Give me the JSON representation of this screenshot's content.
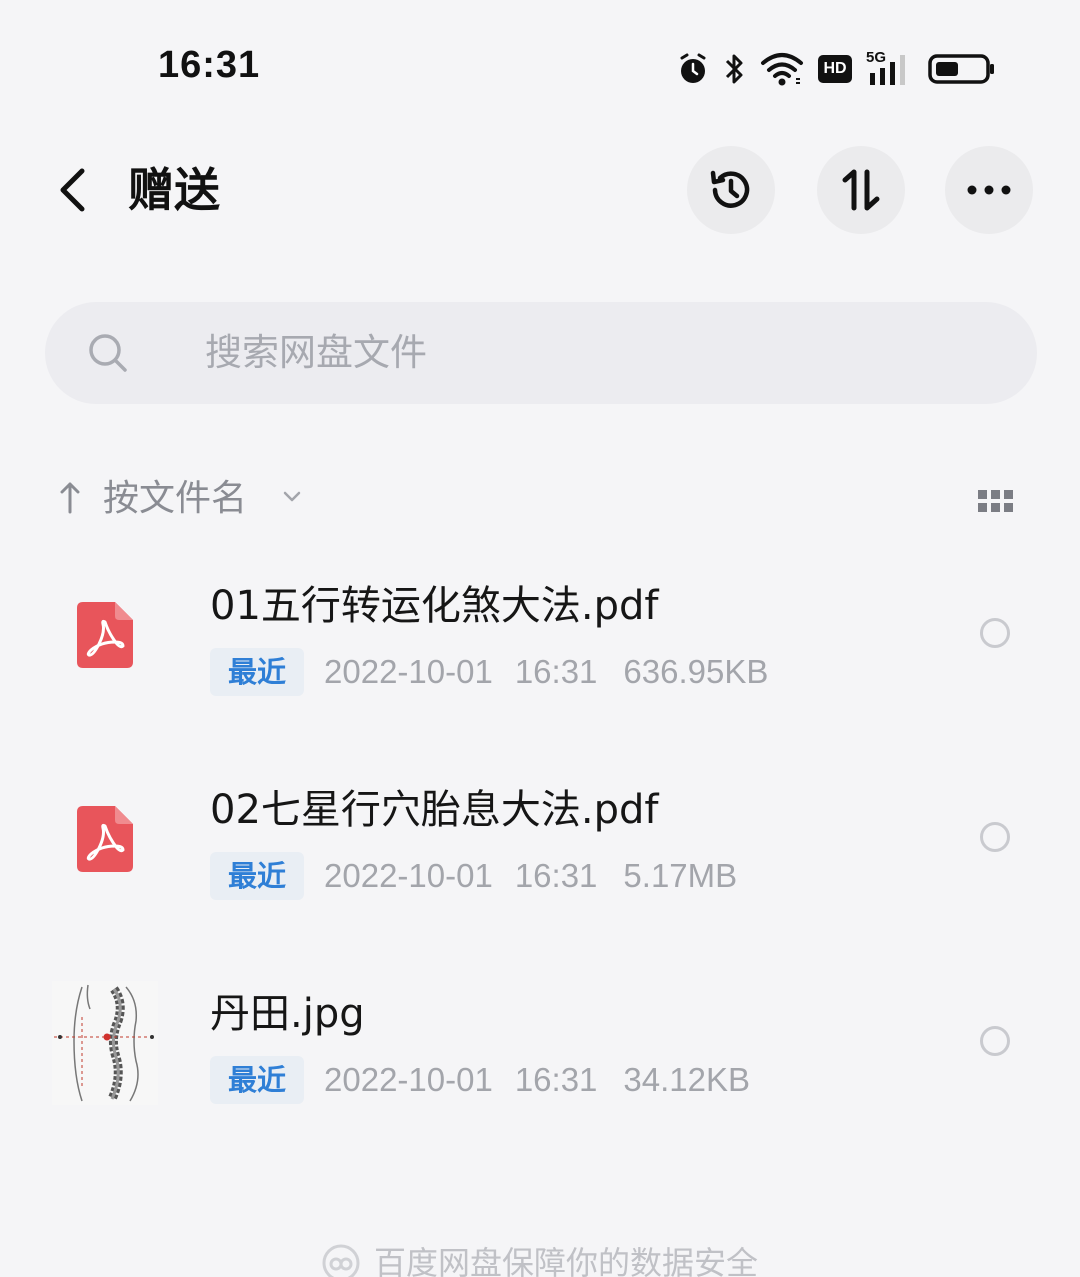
{
  "status_bar": {
    "time": "16:31",
    "icons": [
      "alarm-icon",
      "bluetooth-icon",
      "wifi-icon",
      "hd-icon",
      "5g-signal-icon",
      "battery-icon"
    ],
    "hd_label": "HD",
    "network_label": "5G"
  },
  "header": {
    "title": "赠送",
    "actions": [
      "history-icon",
      "sort-icon",
      "more-icon"
    ]
  },
  "search": {
    "placeholder": "搜索网盘文件"
  },
  "sort_bar": {
    "label": "按文件名",
    "direction": "ascending"
  },
  "files": [
    {
      "name": "01五行转运化煞大法.pdf",
      "badge": "最近",
      "date": "2022-10-01",
      "time": "16:31",
      "size": "636.95KB",
      "icon": "pdf-icon"
    },
    {
      "name": "02七星行穴胎息大法.pdf",
      "badge": "最近",
      "date": "2022-10-01",
      "time": "16:31",
      "size": "5.17MB",
      "icon": "pdf-icon"
    },
    {
      "name": "丹田.jpg",
      "badge": "最近",
      "date": "2022-10-01",
      "time": "16:31",
      "size": "34.12KB",
      "icon": "image-thumbnail"
    }
  ],
  "footer": {
    "text": "百度网盘保障你的数据安全"
  },
  "colors": {
    "background": "#f5f5f7",
    "accent": "#2f7fd6",
    "pdf_red": "#e8555b",
    "meta_gray": "#a3a5ab"
  }
}
